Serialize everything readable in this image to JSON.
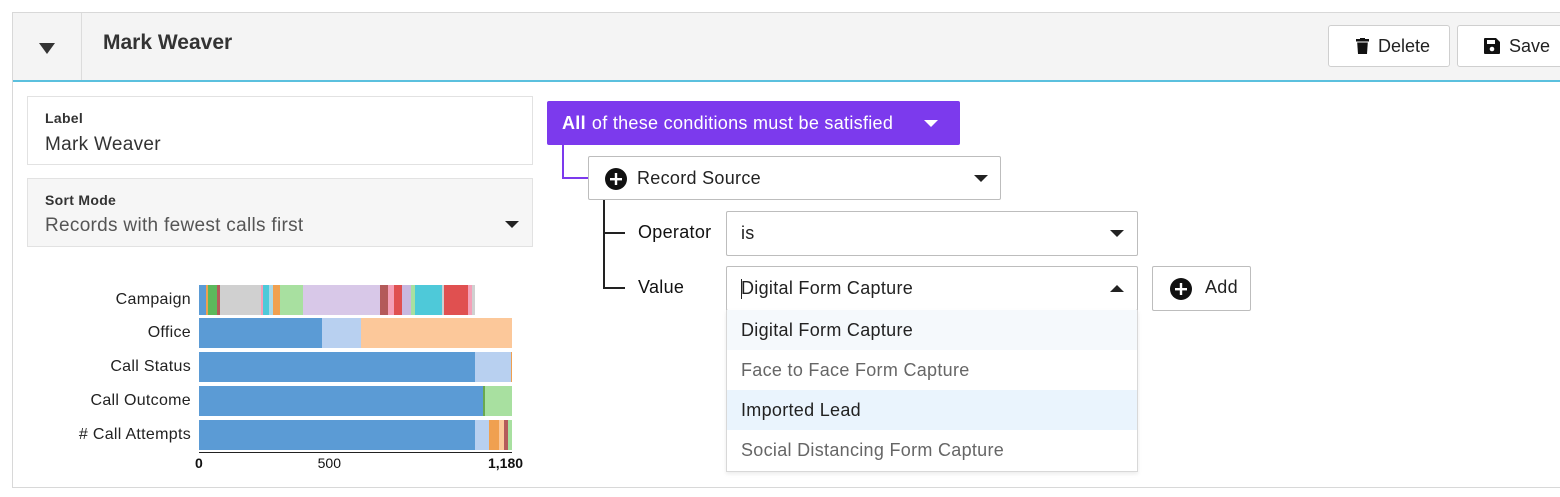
{
  "header": {
    "title": "Mark Weaver",
    "delete_label": "Delete",
    "save_label": "Save"
  },
  "label_field": {
    "label": "Label",
    "value": "Mark Weaver"
  },
  "sort_field": {
    "label": "Sort Mode",
    "value": "Records with fewest calls first"
  },
  "conditions": {
    "mode_strong": "All",
    "mode_text": "of these conditions must be satisfied",
    "field_value": "Record Source",
    "operator_label": "Operator",
    "operator_value": "is",
    "value_label": "Value",
    "value_input": "Digital Form Capture",
    "add_label": "Add",
    "options": [
      "Digital Form Capture",
      "Face to Face Form Capture",
      "Imported Lead",
      "Social Distancing Form Capture"
    ]
  },
  "chart_data": {
    "type": "bar",
    "orientation": "horizontal-stacked",
    "categories": [
      "Campaign",
      "Office",
      "Call Status",
      "Call Outcome",
      "# Call Attempts"
    ],
    "xlim": [
      0,
      1180
    ],
    "x_ticks": [
      "0",
      "500",
      "1,180"
    ],
    "segments": [
      [
        {
          "v": 25,
          "c": "#5b9bd5"
        },
        {
          "v": 8,
          "c": "#f0a050"
        },
        {
          "v": 35,
          "c": "#5cb85c"
        },
        {
          "v": 10,
          "c": "#b45a5a"
        },
        {
          "v": 155,
          "c": "#d0d0d0"
        },
        {
          "v": 10,
          "c": "#f4a0b8"
        },
        {
          "v": 20,
          "c": "#4ec9d9"
        },
        {
          "v": 18,
          "c": "#a8d8e8"
        },
        {
          "v": 25,
          "c": "#f0a050"
        },
        {
          "v": 85,
          "c": "#a8e0a0"
        },
        {
          "v": 290,
          "c": "#d8c8e8"
        },
        {
          "v": 30,
          "c": "#b45a5a"
        },
        {
          "v": 25,
          "c": "#f4a0b8"
        },
        {
          "v": 30,
          "c": "#e05050"
        },
        {
          "v": 35,
          "c": "#c8b8e0"
        },
        {
          "v": 15,
          "c": "#a8e0a0"
        },
        {
          "v": 100,
          "c": "#4ec9d9"
        },
        {
          "v": 10,
          "c": "#d0d0d0"
        },
        {
          "v": 90,
          "c": "#e05050"
        },
        {
          "v": 15,
          "c": "#f4a0b8"
        },
        {
          "v": 10,
          "c": "#d0d0d0"
        }
      ],
      [
        {
          "v": 465,
          "c": "#5b9bd5"
        },
        {
          "v": 145,
          "c": "#b8d0f0"
        },
        {
          "v": 570,
          "c": "#fcc89a"
        }
      ],
      [
        {
          "v": 1040,
          "c": "#5b9bd5"
        },
        {
          "v": 135,
          "c": "#b8d0f0"
        },
        {
          "v": 5,
          "c": "#f0a050"
        }
      ],
      [
        {
          "v": 1070,
          "c": "#5b9bd5"
        },
        {
          "v": 10,
          "c": "#6aa84f"
        },
        {
          "v": 100,
          "c": "#a8e0a0"
        }
      ],
      [
        {
          "v": 1040,
          "c": "#5b9bd5"
        },
        {
          "v": 55,
          "c": "#b8d0f0"
        },
        {
          "v": 35,
          "c": "#f0a050"
        },
        {
          "v": 20,
          "c": "#fcc89a"
        },
        {
          "v": 15,
          "c": "#b45a5a"
        },
        {
          "v": 15,
          "c": "#a8e0a0"
        }
      ]
    ]
  }
}
